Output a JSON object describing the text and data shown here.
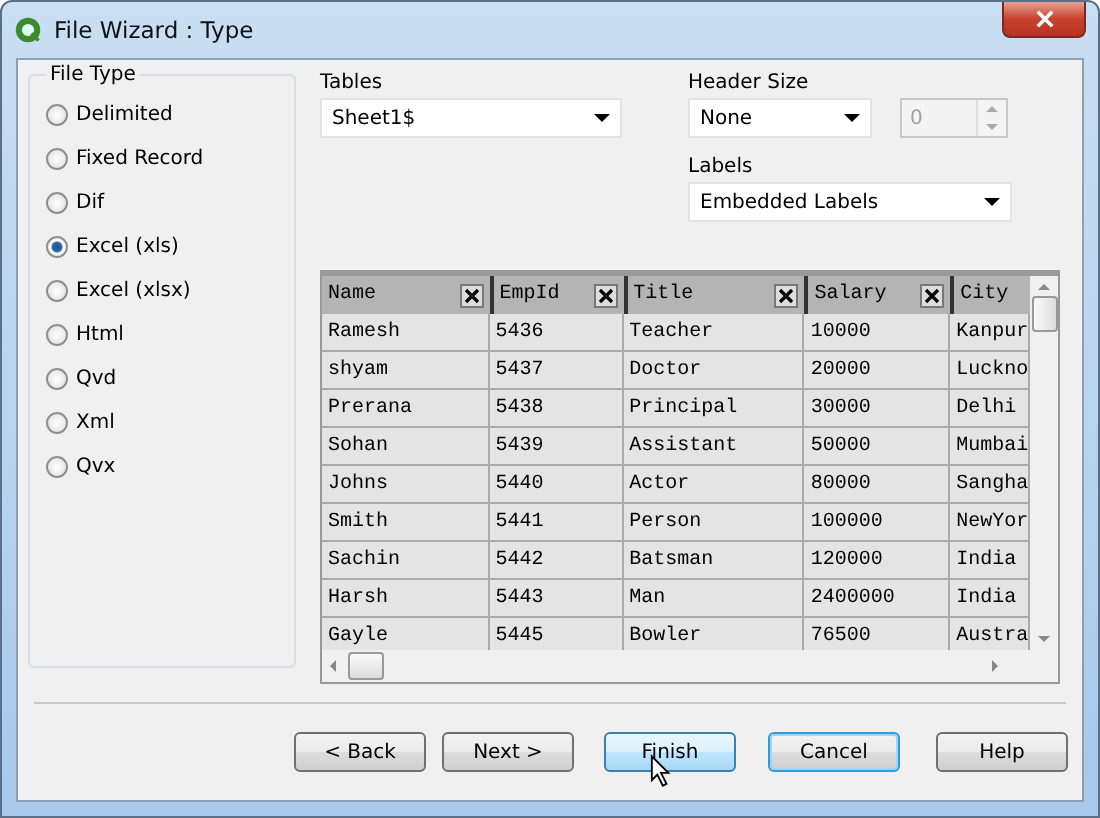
{
  "window": {
    "title": "File Wizard : Type"
  },
  "file_type": {
    "label": "File Type",
    "options": [
      {
        "label": "Delimited",
        "selected": false
      },
      {
        "label": "Fixed Record",
        "selected": false
      },
      {
        "label": "Dif",
        "selected": false
      },
      {
        "label": "Excel (xls)",
        "selected": true
      },
      {
        "label": "Excel (xlsx)",
        "selected": false
      },
      {
        "label": "Html",
        "selected": false
      },
      {
        "label": "Qvd",
        "selected": false
      },
      {
        "label": "Xml",
        "selected": false
      },
      {
        "label": "Qvx",
        "selected": false
      }
    ]
  },
  "tables": {
    "label": "Tables",
    "value": "Sheet1$"
  },
  "header_size": {
    "label": "Header Size",
    "value": "None",
    "spinner_value": "0",
    "spinner_disabled": true
  },
  "labels": {
    "label": "Labels",
    "value": "Embedded Labels"
  },
  "table": {
    "columns": [
      {
        "label": "Name",
        "removable": true
      },
      {
        "label": "EmpId",
        "removable": true
      },
      {
        "label": "Title",
        "removable": true
      },
      {
        "label": "Salary",
        "removable": true
      },
      {
        "label": "City",
        "removable": false
      }
    ],
    "rows": [
      [
        "Ramesh",
        "5436",
        "Teacher",
        "10000",
        "Kanpur"
      ],
      [
        "shyam",
        "5437",
        "Doctor",
        "20000",
        "Luckno"
      ],
      [
        "Prerana",
        "5438",
        "Principal",
        "30000",
        "Delhi"
      ],
      [
        "Sohan",
        "5439",
        "Assistant",
        "50000",
        "Mumbai"
      ],
      [
        "Johns",
        "5440",
        "Actor",
        "80000",
        "Sangha"
      ],
      [
        "Smith",
        "5441",
        "Person",
        "100000",
        "NewYor"
      ],
      [
        "Sachin",
        "5442",
        "Batsman",
        "120000",
        "India"
      ],
      [
        "Harsh",
        "5443",
        "Man",
        "2400000",
        "India"
      ],
      [
        "Gayle",
        "5445",
        "Bowler",
        "76500",
        "Austra"
      ]
    ]
  },
  "buttons": [
    {
      "label": "< Back",
      "hovered": false,
      "default": false
    },
    {
      "label": "Next >",
      "hovered": false,
      "default": false
    },
    {
      "label": "Finish",
      "hovered": true,
      "default": false
    },
    {
      "label": "Cancel",
      "hovered": false,
      "default": true
    },
    {
      "label": "Help",
      "hovered": false,
      "default": false
    }
  ]
}
